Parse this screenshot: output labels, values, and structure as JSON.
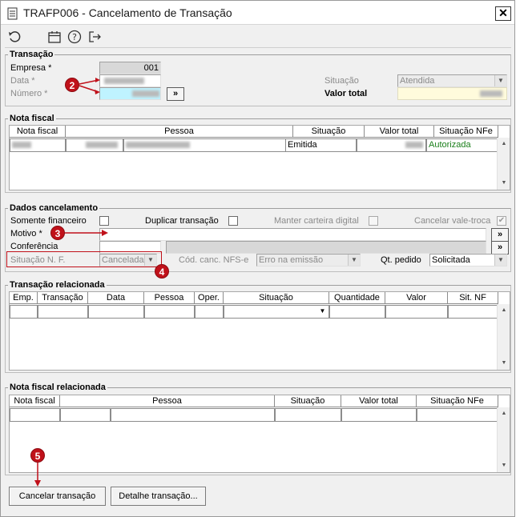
{
  "window": {
    "title": "TRAFP006 - Cancelamento de Transação",
    "close_glyph": "✕"
  },
  "toolbar": {
    "icons": [
      "undo-icon",
      "calendar-icon",
      "help-icon",
      "exit-icon"
    ]
  },
  "transacao": {
    "legend": "Transação",
    "empresa_label": "Empresa *",
    "empresa_value": "001",
    "data_label": "Data *",
    "numero_label": "Número *",
    "go_glyph": "»",
    "situacao_label": "Situação",
    "situacao_value": "Atendida",
    "valor_total_label": "Valor total"
  },
  "nota_fiscal": {
    "legend": "Nota fiscal",
    "columns": [
      "Nota fiscal",
      "Pessoa",
      "Situação",
      "Valor total",
      "Situação NFe"
    ],
    "row": {
      "situacao": "Emitida",
      "situacao_nfe": "Autorizada"
    }
  },
  "dados": {
    "legend": "Dados cancelamento",
    "somente_financeiro": "Somente financeiro",
    "duplicar_transacao": "Duplicar transação",
    "manter_carteira": "Manter carteira digital",
    "cancelar_vale_troca": "Cancelar vale-troca",
    "motivo_label": "Motivo *",
    "conferencia_label": "Conferência",
    "situacao_nf_label": "Situação N. F.",
    "situacao_nf_value": "Cancelada",
    "cod_canc_label": "Cód. canc. NFS-e",
    "cod_canc_value": "Erro na emissão",
    "qt_pedido_label": "Qt. pedido",
    "qt_pedido_value": "Solicitada",
    "go_glyph": "»"
  },
  "transacao_relacionada": {
    "legend": "Transação relacionada",
    "columns": [
      "Emp.",
      "Transação",
      "Data",
      "Pessoa",
      "Oper.",
      "Situação",
      "Quantidade",
      "Valor",
      "Sit. NF"
    ]
  },
  "nota_relacionada": {
    "legend": "Nota fiscal relacionada",
    "columns": [
      "Nota fiscal",
      "Pessoa",
      "Situação",
      "Valor total",
      "Situação NFe"
    ]
  },
  "buttons": {
    "cancelar": "Cancelar transação",
    "detalhe": "Detalhe transação..."
  },
  "annotations": [
    "2",
    "3",
    "4",
    "5"
  ],
  "colors": {
    "annotation": "#c0111a",
    "authorized": "#1a7f1a",
    "numero_bg": "#bff3ff",
    "valor_bg": "#fffbdc"
  }
}
